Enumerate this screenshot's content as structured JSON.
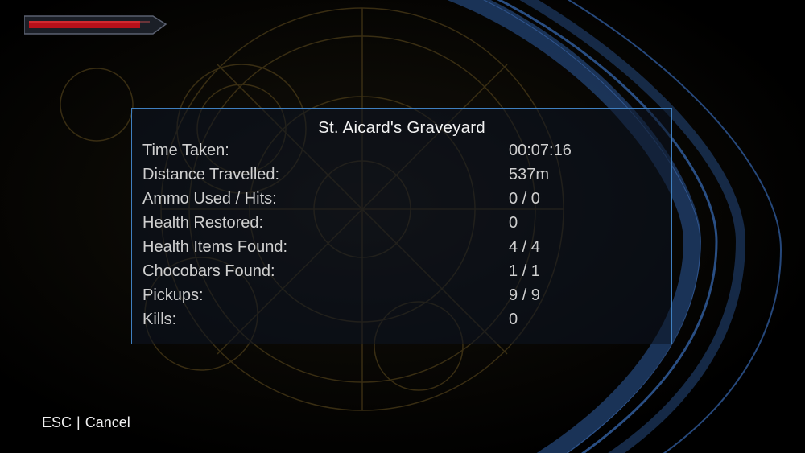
{
  "hud": {
    "health_fraction": 0.92,
    "health_color": "#b8101a"
  },
  "level_summary": {
    "title": "St. Aicard's Graveyard",
    "stats": [
      {
        "label": "Time Taken:",
        "value": "00:07:16"
      },
      {
        "label": "Distance Travelled:",
        "value": "537m"
      },
      {
        "label": "Ammo Used / Hits:",
        "value": "0 / 0"
      },
      {
        "label": "Health Restored:",
        "value": "0"
      },
      {
        "label": "Health Items Found:",
        "value": "4 / 4"
      },
      {
        "label": "Chocobars Found:",
        "value": "1 / 1"
      },
      {
        "label": "Pickups:",
        "value": "9 / 9"
      },
      {
        "label": "Kills:",
        "value": "0"
      }
    ]
  },
  "controls": {
    "cancel_key": "ESC",
    "separator": "|",
    "cancel_label": "Cancel"
  }
}
